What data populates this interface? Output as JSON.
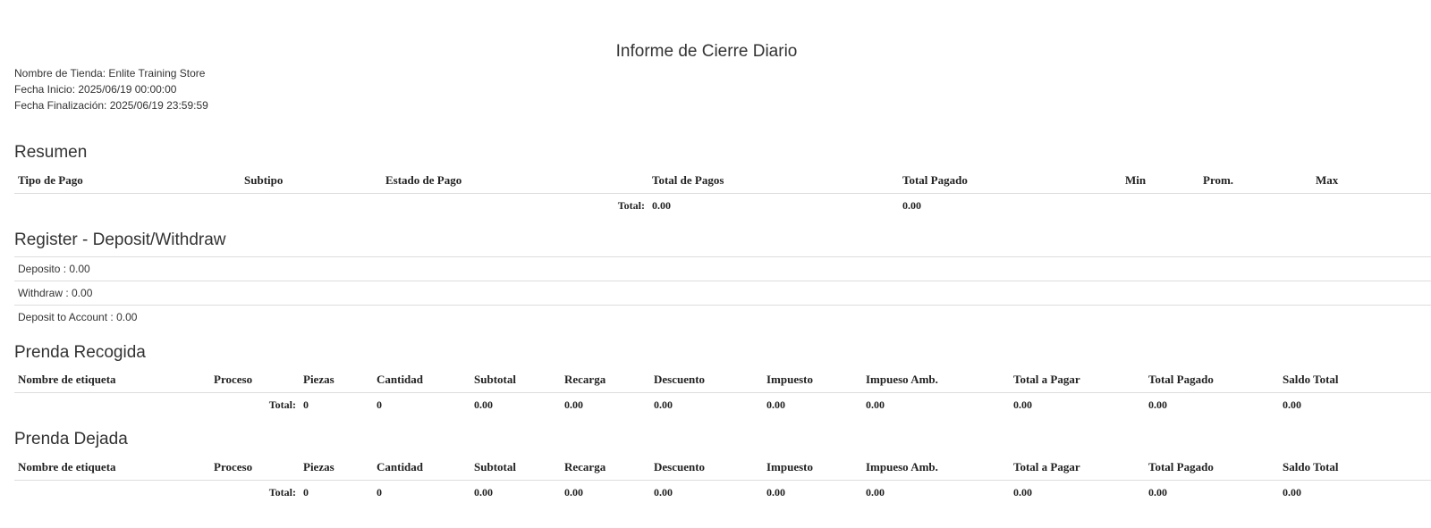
{
  "report": {
    "title": "Informe de Cierre Diario",
    "store_line": "Nombre de Tienda: Enlite Training Store",
    "start_line": "Fecha Inicio: 2025/06/19 00:00:00",
    "end_line": "Fecha Finalización: 2025/06/19 23:59:59"
  },
  "summary": {
    "title": "Resumen",
    "headers": [
      "Tipo de Pago",
      "Subtipo",
      "Estado de Pago",
      "Total de Pagos",
      "Total Pagado",
      "Min",
      "Prom.",
      "Max"
    ],
    "total_label": "Total:",
    "total_payments": "0.00",
    "total_paid": "0.00"
  },
  "register": {
    "title": "Register - Deposit/Withdraw",
    "deposit": "Deposito : 0.00",
    "withdraw": "Withdraw : 0.00",
    "deposit_to_account": "Deposit to Account : 0.00"
  },
  "garments_picked": {
    "title": "Prenda Recogida",
    "headers": [
      "Nombre de etiqueta",
      "Proceso",
      "Piezas",
      "Cantidad",
      "Subtotal",
      "Recarga",
      "Descuento",
      "Impuesto",
      "Impueso Amb.",
      "Total a Pagar",
      "Total Pagado",
      "Saldo Total"
    ],
    "total_label": "Total:",
    "totals": [
      "0",
      "0",
      "0.00",
      "0.00",
      "0.00",
      "0.00",
      "0.00",
      "0.00",
      "0.00",
      "0.00"
    ]
  },
  "garments_dropped": {
    "title": "Prenda Dejada",
    "headers": [
      "Nombre de etiqueta",
      "Proceso",
      "Piezas",
      "Cantidad",
      "Subtotal",
      "Recarga",
      "Descuento",
      "Impuesto",
      "Impueso Amb.",
      "Total a Pagar",
      "Total Pagado",
      "Saldo Total"
    ],
    "total_label": "Total:",
    "totals": [
      "0",
      "0",
      "0.00",
      "0.00",
      "0.00",
      "0.00",
      "0.00",
      "0.00",
      "0.00",
      "0.00"
    ]
  }
}
